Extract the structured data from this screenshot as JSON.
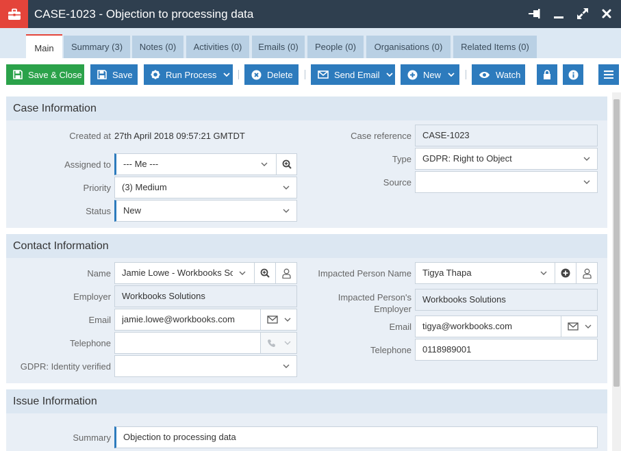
{
  "window": {
    "title": "CASE-1023 - Objection to processing data",
    "icon": "briefcase-icon",
    "controls": [
      "pin-icon",
      "minimize-icon",
      "maximize-icon",
      "close-icon"
    ]
  },
  "tabs": [
    {
      "label": "Main",
      "active": true
    },
    {
      "label": "Summary (3)"
    },
    {
      "label": "Notes (0)"
    },
    {
      "label": "Activities (0)"
    },
    {
      "label": "Emails (0)"
    },
    {
      "label": "People (0)"
    },
    {
      "label": "Organisations (0)"
    },
    {
      "label": "Related Items (0)"
    }
  ],
  "toolbar": {
    "save_close": "Save & Close",
    "save": "Save",
    "run_process": "Run Process",
    "delete": "Delete",
    "send_email": "Send Email",
    "new": "New",
    "watch": "Watch"
  },
  "case_info": {
    "title": "Case Information",
    "created_label": "Created at",
    "created_value": "27th April 2018 09:57:21 GMTDT",
    "assigned_label": "Assigned to",
    "assigned_value": "--- Me ---",
    "priority_label": "Priority",
    "priority_value": "(3) Medium",
    "status_label": "Status",
    "status_value": "New",
    "case_ref_label": "Case reference",
    "case_ref_value": "CASE-1023",
    "type_label": "Type",
    "type_value": "GDPR: Right to Object",
    "source_label": "Source",
    "source_value": ""
  },
  "contact_info": {
    "title": "Contact Information",
    "name_label": "Name",
    "name_value": "Jamie Lowe - Workbooks Solutions",
    "employer_label": "Employer",
    "employer_value": "Workbooks Solutions",
    "email_label": "Email",
    "email_value": "jamie.lowe@workbooks.com",
    "telephone_label": "Telephone",
    "telephone_value": "",
    "gdpr_label": "GDPR: Identity verified",
    "gdpr_value": "",
    "impacted_name_label": "Impacted Person Name",
    "impacted_name_value": "Tigya Thapa",
    "impacted_employer_label_1": "Impacted Person's",
    "impacted_employer_label_2": "Employer",
    "impacted_employer_value": "Workbooks Solutions",
    "impacted_email_label": "Email",
    "impacted_email_value": "tigya@workbooks.com",
    "impacted_phone_label": "Telephone",
    "impacted_phone_value": "0118989001"
  },
  "issue_info": {
    "title": "Issue Information",
    "summary_label": "Summary",
    "summary_value": "Objection to processing data"
  },
  "colors": {
    "titlebar": "#2f3f4f",
    "accent_red": "#e4443a",
    "button_blue": "#2d7bbd",
    "button_green": "#2ba24a"
  }
}
